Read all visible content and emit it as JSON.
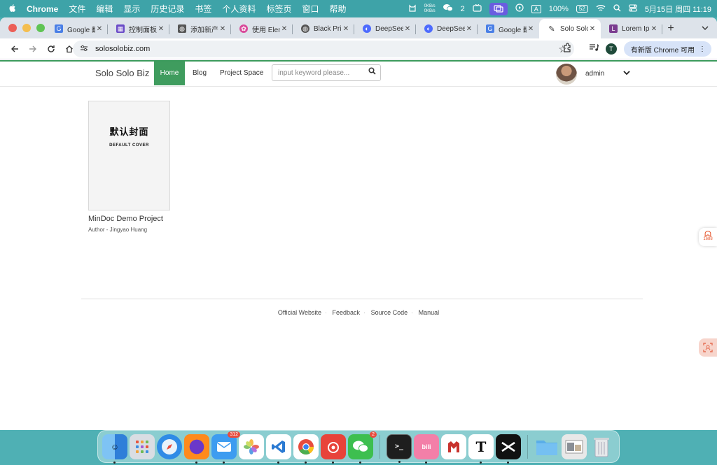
{
  "menubar": {
    "apple": "",
    "app_name": "Chrome",
    "menus": [
      "文件",
      "编辑",
      "显示",
      "历史记录",
      "书签",
      "个人资料",
      "标签页",
      "窗口",
      "帮助"
    ],
    "net_up": "0KB/s",
    "net_down": "0KB/s",
    "wechat_count": "2",
    "input_method": "A",
    "battery_pct": "100%",
    "battery_level": "52",
    "datetime": "5月15日 周四  11:19"
  },
  "browser": {
    "tabs": [
      {
        "title": "Google 翻译",
        "icon": "translate-icon",
        "color": "#4a7fe6"
      },
      {
        "title": "控制面板 | 应用",
        "icon": "panel-icon",
        "color": "#6a4bc7"
      },
      {
        "title": "添加新产品",
        "icon": "globe-icon",
        "color": "#555555"
      },
      {
        "title": "使用 Element",
        "icon": "element-icon",
        "color": "#d94a9a"
      },
      {
        "title": "Black Print",
        "icon": "globe-icon",
        "color": "#555555"
      },
      {
        "title": "DeepSeek",
        "icon": "deepseek-icon",
        "color": "#4d6bfe"
      },
      {
        "title": "DeepSeek",
        "icon": "deepseek-icon",
        "color": "#4d6bfe"
      },
      {
        "title": "Google 翻译",
        "icon": "translate-icon",
        "color": "#4a7fe6"
      },
      {
        "title": "Solo Solo Biz",
        "icon": "edit-icon",
        "color": "#333333",
        "active": true
      },
      {
        "title": "Lorem Ipsum",
        "icon": "lorem-icon",
        "color": "#7a3b8f"
      }
    ],
    "new_tab": "+",
    "url": "solosolobiz.com",
    "profile_initial": "T",
    "update_label": "有新版 Chrome 可用"
  },
  "site": {
    "brand": "Solo Solo Biz",
    "nav": [
      "Home",
      "Blog",
      "Project Space"
    ],
    "search_placeholder": "input keyword please...",
    "username": "admin"
  },
  "project": {
    "cover_cn": "默认封面",
    "cover_en": "DEFAULT COVER",
    "title": "MinDoc Demo Project",
    "author": "Author - Jingyao Huang"
  },
  "footer": {
    "links": [
      "Official Website",
      "Feedback",
      "Source Code",
      "Manual"
    ]
  },
  "side_floats": {
    "ali_label": "1688"
  },
  "dock": {
    "mail_badge": "312",
    "wechat_badge": "2",
    "apps": [
      "Finder",
      "Launchpad",
      "Safari",
      "Firefox",
      "Mail",
      "Photos",
      "VS Code",
      "Chrome",
      "NetEase Music",
      "WeChat",
      "Terminal",
      "bilibili",
      "Stop Motion",
      "Typora",
      "CapCut",
      "Folder",
      "Preview",
      "Trash"
    ]
  }
}
